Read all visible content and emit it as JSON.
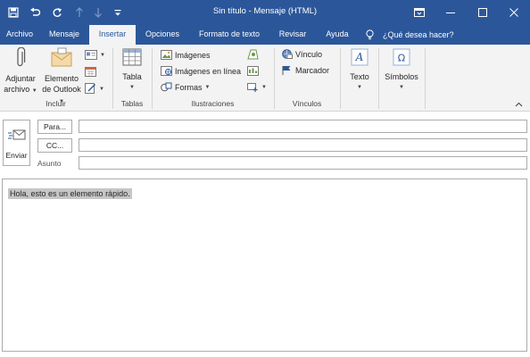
{
  "window": {
    "title": "Sin título  -  Mensaje (HTML)",
    "colors": {
      "accent": "#2b579a",
      "ribbon_bg": "#f3f3f3",
      "highlight": "#c6c6c6"
    }
  },
  "quick_access": [
    "save-icon",
    "undo-icon",
    "redo-icon",
    "up-arrow-icon",
    "down-arrow-icon",
    "customize-icon"
  ],
  "window_controls": [
    "ribbon-display-icon",
    "minimize-icon",
    "restore-icon",
    "close-icon"
  ],
  "tabs": [
    {
      "label": "Archivo",
      "active": false
    },
    {
      "label": "Mensaje",
      "active": false
    },
    {
      "label": "Insertar",
      "active": true
    },
    {
      "label": "Opciones",
      "active": false
    },
    {
      "label": "Formato de texto",
      "active": false
    },
    {
      "label": "Revisar",
      "active": false
    },
    {
      "label": "Ayuda",
      "active": false
    }
  ],
  "tell_me": "¿Qué desea hacer?",
  "ribbon": {
    "incluir": {
      "label": "Incluir",
      "attach_line1": "Adjuntar",
      "attach_line2": "archivo",
      "outlook_line1": "Elemento",
      "outlook_line2": "de Outlook"
    },
    "tablas": {
      "label": "Tablas",
      "table": "Tabla"
    },
    "ilustraciones": {
      "label": "Ilustraciones",
      "images": "Imágenes",
      "online_images": "Imágenes en línea",
      "shapes": "Formas"
    },
    "vinculos": {
      "label": "Vínculos",
      "link": "Vínculo",
      "bookmark": "Marcador"
    },
    "texto": {
      "label": "Texto"
    },
    "simbolos": {
      "label": "Símbolos"
    }
  },
  "compose": {
    "send": "Enviar",
    "to": "Para...",
    "cc": "CC...",
    "subject": "Asunto",
    "to_value": "",
    "cc_value": "",
    "subject_value": ""
  },
  "body": {
    "text": "Hola, esto es un elemento rápido."
  }
}
